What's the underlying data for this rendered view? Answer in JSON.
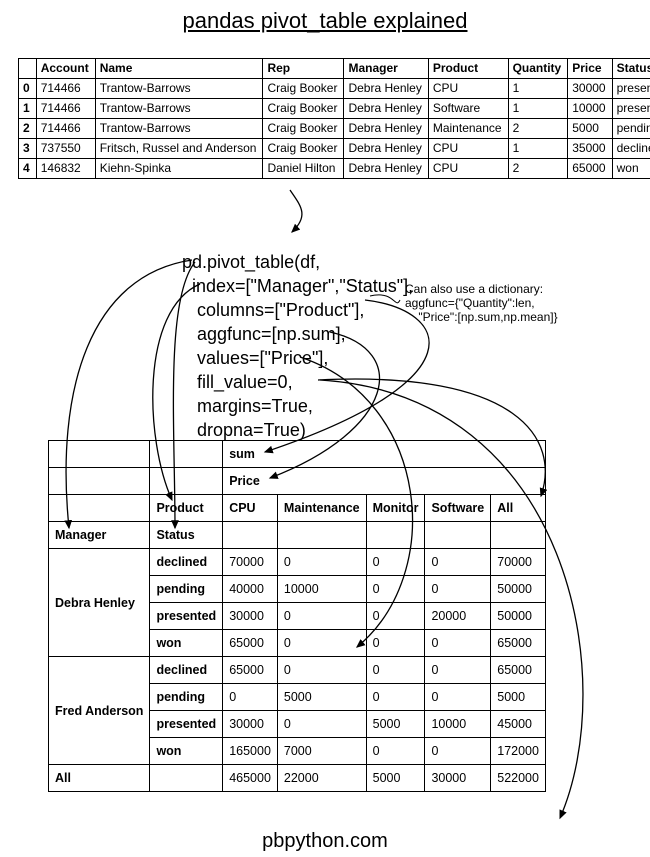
{
  "title": "pandas pivot_table explained",
  "footer": "pbpython.com",
  "source_table": {
    "headers": [
      "",
      "Account",
      "Name",
      "Rep",
      "Manager",
      "Product",
      "Quantity",
      "Price",
      "Status"
    ],
    "rows": [
      [
        "0",
        "714466",
        "Trantow-Barrows",
        "Craig Booker",
        "Debra Henley",
        "CPU",
        "1",
        "30000",
        "presented"
      ],
      [
        "1",
        "714466",
        "Trantow-Barrows",
        "Craig Booker",
        "Debra Henley",
        "Software",
        "1",
        "10000",
        "presented"
      ],
      [
        "2",
        "714466",
        "Trantow-Barrows",
        "Craig Booker",
        "Debra Henley",
        "Maintenance",
        "2",
        "5000",
        "pending"
      ],
      [
        "3",
        "737550",
        "Fritsch, Russel and Anderson",
        "Craig Booker",
        "Debra Henley",
        "CPU",
        "1",
        "35000",
        "declined"
      ],
      [
        "4",
        "146832",
        "Kiehn-Spinka",
        "Daniel Hilton",
        "Debra Henley",
        "CPU",
        "2",
        "65000",
        "won"
      ]
    ]
  },
  "code": {
    "l1": "pd.pivot_table(df,",
    "l2": "  index=[\"Manager\",\"Status\"],",
    "l3": "   columns=[\"Product\"],",
    "l4": "   aggfunc=[np.sum],",
    "l5": "   values=[\"Price\"],",
    "l6": "   fill_value=0,",
    "l7": "   margins=True,",
    "l8": "   dropna=True)"
  },
  "annotation": "Can also use a dictionary:\naggfunc={\"Quantity\":len,\n    \"Price\":[np.sum,np.mean]}",
  "pivot": {
    "agg_label": "sum",
    "value_label": "Price",
    "col_header_label": "Product",
    "columns": [
      "CPU",
      "Maintenance",
      "Monitor",
      "Software",
      "All"
    ],
    "index_names": [
      "Manager",
      "Status"
    ],
    "all_label": "All",
    "groups": [
      {
        "manager": "Debra Henley",
        "rows": [
          {
            "status": "declined",
            "cells": [
              "70000",
              "0",
              "0",
              "0",
              "70000"
            ]
          },
          {
            "status": "pending",
            "cells": [
              "40000",
              "10000",
              "0",
              "0",
              "50000"
            ]
          },
          {
            "status": "presented",
            "cells": [
              "30000",
              "0",
              "0",
              "20000",
              "50000"
            ]
          },
          {
            "status": "won",
            "cells": [
              "65000",
              "0",
              "0",
              "0",
              "65000"
            ]
          }
        ]
      },
      {
        "manager": "Fred Anderson",
        "rows": [
          {
            "status": "declined",
            "cells": [
              "65000",
              "0",
              "0",
              "0",
              "65000"
            ]
          },
          {
            "status": "pending",
            "cells": [
              "0",
              "5000",
              "0",
              "0",
              "5000"
            ]
          },
          {
            "status": "presented",
            "cells": [
              "30000",
              "0",
              "5000",
              "10000",
              "45000"
            ]
          },
          {
            "status": "won",
            "cells": [
              "165000",
              "7000",
              "0",
              "0",
              "172000"
            ]
          }
        ]
      }
    ],
    "totals": [
      "465000",
      "22000",
      "5000",
      "30000",
      "522000"
    ]
  }
}
